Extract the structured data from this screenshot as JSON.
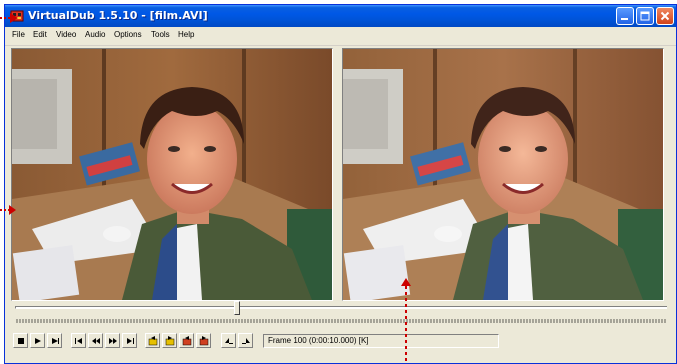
{
  "window": {
    "title": "VirtualDub 1.5.10 - [film.AVI]"
  },
  "menu": [
    "File",
    "Edit",
    "Video",
    "Audio",
    "Options",
    "Tools",
    "Help"
  ],
  "panes": {
    "input_label": "input video pane",
    "output_label": "output video pane"
  },
  "position_slider": {
    "value_fraction": 0.34
  },
  "status": {
    "frame_text": "Frame 100 (0:00:10.000) [K]"
  },
  "annotation_arrows": {
    "color": "#cc0000"
  }
}
